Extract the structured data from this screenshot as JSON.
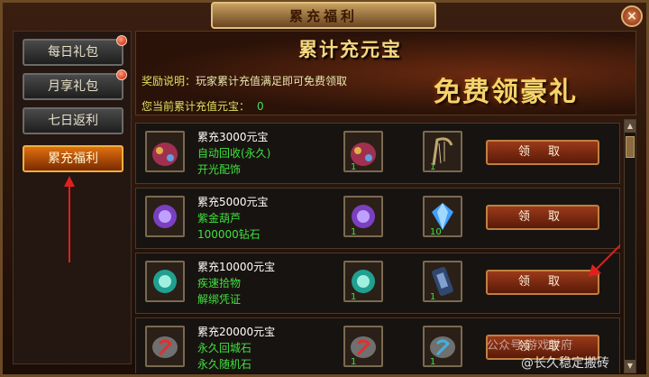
{
  "window": {
    "title": "累充福利",
    "close_label": "×"
  },
  "sidebar": {
    "items": [
      {
        "label": "每日礼包",
        "has_dot": true,
        "active": false
      },
      {
        "label": "月享礼包",
        "has_dot": true,
        "active": false
      },
      {
        "label": "七日返利",
        "has_dot": false,
        "active": false
      },
      {
        "label": "累充福利",
        "has_dot": false,
        "active": true
      }
    ]
  },
  "banner": {
    "title": "累计充元宝",
    "slogan": "免费领豪礼",
    "desc_label": "奖励说明：",
    "desc_text": "玩家累计充值满足即可免费领取",
    "current_label": "您当前累计充值元宝：",
    "current_value": "0"
  },
  "rewards": [
    {
      "title": "累充3000元宝",
      "line2": "自动回收(永久)",
      "line3": "开光配饰",
      "slot1": {
        "icon": "bag-icon",
        "qty": "1"
      },
      "slot2": {
        "icon": "harp-icon",
        "qty": "1"
      },
      "claim": "领 取"
    },
    {
      "title": "累充5000元宝",
      "line2": "紫金葫芦",
      "line3": "100000钻石",
      "slot1": {
        "icon": "orb-icon",
        "qty": "1"
      },
      "slot2": {
        "icon": "diamond-icon",
        "qty": "10"
      },
      "claim": "领 取"
    },
    {
      "title": "累充10000元宝",
      "line2": "疾速拾物",
      "line3": "解绑凭证",
      "slot1": {
        "icon": "orb-icon",
        "qty": "1"
      },
      "slot2": {
        "icon": "scroll-icon",
        "qty": "1"
      },
      "claim": "领 取"
    },
    {
      "title": "累充20000元宝",
      "line2": "永久回城石",
      "line3": "永久随机石",
      "slot1": {
        "icon": "stone-icon",
        "qty": "1"
      },
      "slot2": {
        "icon": "stone-icon",
        "qty": "1"
      },
      "claim": "领 取"
    }
  ],
  "watermark": {
    "line1": "公众号·游戏学府",
    "line2": "@长久稳定搬砖"
  },
  "colors": {
    "accent": "#e07010",
    "gold": "#f6d36a",
    "green": "#40e040"
  }
}
